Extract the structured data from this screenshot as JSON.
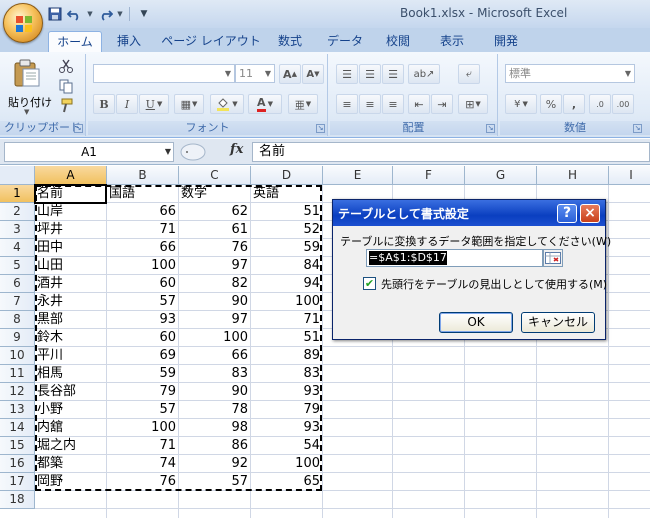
{
  "window": {
    "title": "Book1.xlsx - Microsoft Excel"
  },
  "quick_access": {
    "icons": [
      "save-icon",
      "undo-icon",
      "redo-icon",
      "customize-icon"
    ]
  },
  "ribbon": {
    "tabs": [
      {
        "label": "ホーム",
        "active": true
      },
      {
        "label": "挿入",
        "active": false
      },
      {
        "label": "ページ レイアウト",
        "active": false
      },
      {
        "label": "数式",
        "active": false
      },
      {
        "label": "データ",
        "active": false
      },
      {
        "label": "校閲",
        "active": false
      },
      {
        "label": "表示",
        "active": false
      },
      {
        "label": "開発",
        "active": false
      }
    ],
    "groups": {
      "clipboard": {
        "label": "クリップボード",
        "paste_label": "貼り付け"
      },
      "font": {
        "label": "フォント",
        "font_name": "",
        "font_size": "11"
      },
      "alignment": {
        "label": "配置"
      },
      "number": {
        "label": "数値",
        "format": "標準"
      }
    }
  },
  "formula_bar": {
    "name_box": "A1",
    "fx_label": "fx",
    "content": "名前"
  },
  "sheet": {
    "columns": [
      "A",
      "B",
      "C",
      "D",
      "E",
      "F",
      "G",
      "H",
      "I"
    ],
    "rows": [
      "1",
      "2",
      "3",
      "4",
      "5",
      "6",
      "7",
      "8",
      "9",
      "10",
      "11",
      "12",
      "13",
      "14",
      "15",
      "16",
      "17",
      "18"
    ],
    "headers": [
      "名前",
      "国語",
      "数学",
      "英語"
    ],
    "data": [
      [
        "山岸",
        "66",
        "62",
        "51"
      ],
      [
        "坪井",
        "71",
        "61",
        "52"
      ],
      [
        "田中",
        "66",
        "76",
        "59"
      ],
      [
        "山田",
        "100",
        "97",
        "84"
      ],
      [
        "酒井",
        "60",
        "82",
        "94"
      ],
      [
        "永井",
        "57",
        "90",
        "100"
      ],
      [
        "黒部",
        "93",
        "97",
        "71"
      ],
      [
        "鈴木",
        "60",
        "100",
        "51"
      ],
      [
        "平川",
        "69",
        "66",
        "89"
      ],
      [
        "相馬",
        "59",
        "83",
        "83"
      ],
      [
        "長谷部",
        "79",
        "90",
        "93"
      ],
      [
        "小野",
        "57",
        "78",
        "79"
      ],
      [
        "内舘",
        "100",
        "98",
        "93"
      ],
      [
        "堀之内",
        "71",
        "86",
        "54"
      ],
      [
        "都築",
        "74",
        "92",
        "100"
      ],
      [
        "岡野",
        "76",
        "57",
        "65"
      ]
    ]
  },
  "dialog": {
    "title": "テーブルとして書式設定",
    "help_label": "?",
    "close_label": "×",
    "prompt": "テーブルに変換するデータ範囲を指定してください(W)",
    "range_value": "=$A$1:$D$17",
    "checkbox_checked": true,
    "checkbox_label": "先頭行をテーブルの見出しとして使用する(M)",
    "ok_label": "OK",
    "cancel_label": "キャンセル"
  },
  "colors": {
    "ribbon_bg": "#dbe7f5",
    "dialog_title": "#0a3fc0",
    "selected_header": "#f1c15f"
  }
}
